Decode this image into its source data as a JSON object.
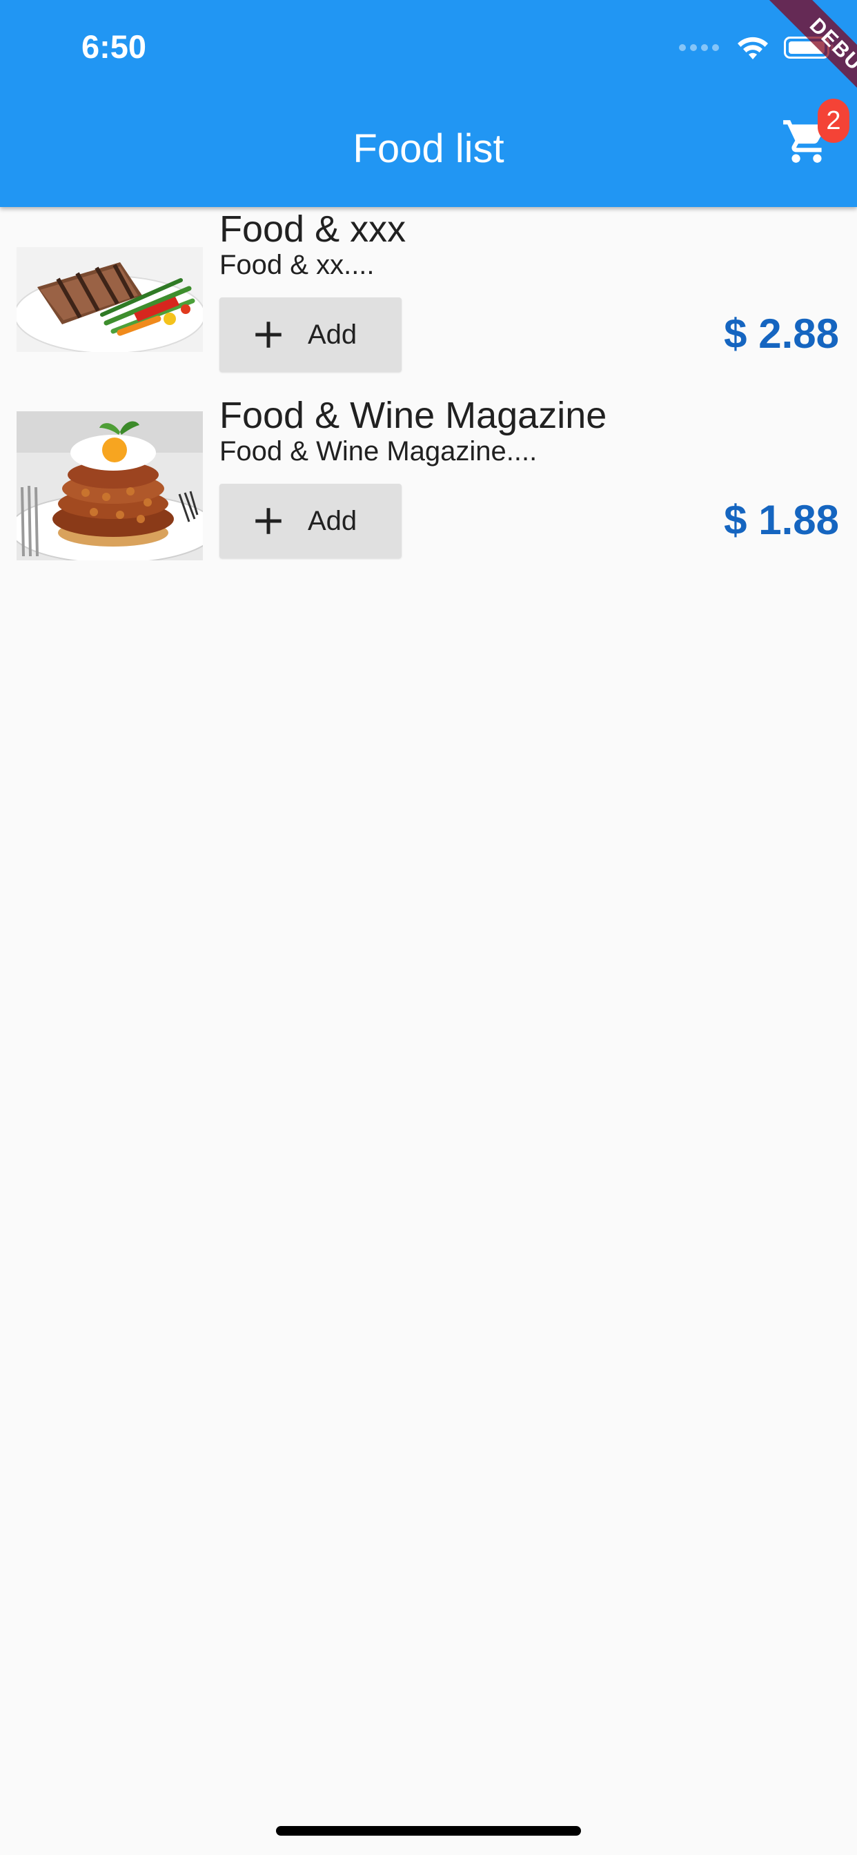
{
  "status_bar": {
    "time": "6:50"
  },
  "app_bar": {
    "title": "Food list",
    "cart_count": "2"
  },
  "debug_banner": "DEBUG",
  "items": [
    {
      "name": "Food & xxx",
      "description": "Food & xx....",
      "add_label": "Add",
      "price": "$ 2.88",
      "image": "grilled-salmon-with-vegetables"
    },
    {
      "name": "Food & Wine Magazine",
      "description": "Food & Wine Magazine....",
      "add_label": "Add",
      "price": "$ 1.88",
      "image": "baked-beans-stack-with-fried-egg"
    }
  ],
  "colors": {
    "app_bar": "#2196F3",
    "price": "#1565C0",
    "badge": "#F44336",
    "button": "#E0E0E0",
    "background": "#FAFAFA"
  }
}
